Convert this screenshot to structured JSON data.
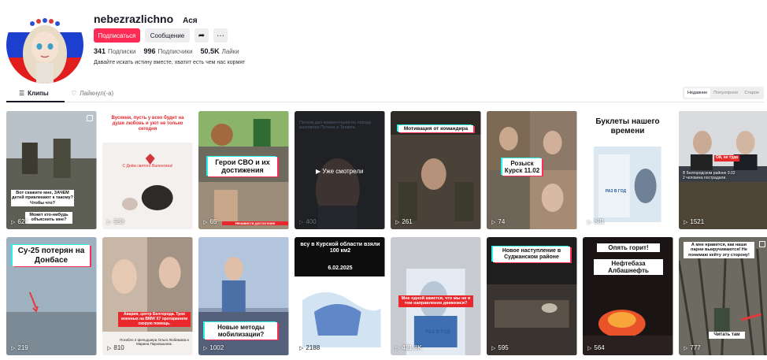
{
  "profile": {
    "username": "nebezrazlichno",
    "nickname": "Ася",
    "follow_label": "Подписаться",
    "message_label": "Сообщение",
    "share_icon": "share-icon",
    "more_icon": "more-icon",
    "following_count": "341",
    "following_label": "Подписки",
    "followers_count": "996",
    "followers_label": "Подписчики",
    "likes_count": "50.5K",
    "likes_label": "Лайки",
    "bio": "Давайте искать истину вместе, хватит есть чем нас кормят"
  },
  "tabs": {
    "clips": "Клипы",
    "liked": "Лайкнул(-а)",
    "sort": [
      "Недавние",
      "Популярное",
      "Старое"
    ]
  },
  "videos": [
    {
      "views": "627",
      "caption": "Вот скажите мне, ЗАЧЕМ детей привлекают к такому? Чтобы что?",
      "caption2": "Может кто-нибудь объяснить мне?"
    },
    {
      "views": "933",
      "caption": "Вусякни, пусть у всех будет на душе любовь и уют не только сегодня",
      "caption2": "С Днём святого Валентина!"
    },
    {
      "views": "65",
      "caption": "Герои СВО и их достижения",
      "caption2": "Ненависти достаточно"
    },
    {
      "views": "400",
      "caption": "Песков дал комментарии по поводу разговора Путина и Трампа.",
      "caption2": "Уже смотрели"
    },
    {
      "views": "261",
      "caption": "Мотивация от командира"
    },
    {
      "views": "74",
      "caption": "Розыск Курск 11.02"
    },
    {
      "views": "681",
      "caption": "Буклеты нашего времени",
      "caption2": "РАЗ В ГОД"
    },
    {
      "views": "1521",
      "caption": "Ой, не туда",
      "caption2": "В Белгородском районе 9.02 2 человека пострадали."
    },
    {
      "views": "219",
      "caption": "Су-25 потерян на Донбасе"
    },
    {
      "views": "810",
      "caption": "Авария, центр Белгорода. Трое военных на BMW X7 протаранили скорую помощь.",
      "caption2": "Погибло 2 фельдшера Ольга Любимова и Марина Паровышник."
    },
    {
      "views": "1002",
      "caption": "Новые методы мобилизации?"
    },
    {
      "views": "2188",
      "caption": "всу в Курской области взяли 100 км2",
      "caption2": "6.02.2025"
    },
    {
      "views": "421.8K",
      "caption": "Мне одной кажется, что мы не в том направлении движемся?",
      "caption2": "РАЗ В ГОД"
    },
    {
      "views": "595",
      "caption": "Новое наступление в Суджанском районе"
    },
    {
      "views": "564",
      "caption": "Опять горит!",
      "caption2": "Нефтебаза Албашнефть"
    },
    {
      "views": "777",
      "caption": "А мне нравится, как наши парни выкручиваются! Не понимаю кейту эту сторону!",
      "caption2": "Читать там"
    }
  ],
  "colors": {
    "accent": "#fe2c55",
    "tiktok_cyan": "#25f4ee",
    "text": "#161823"
  }
}
